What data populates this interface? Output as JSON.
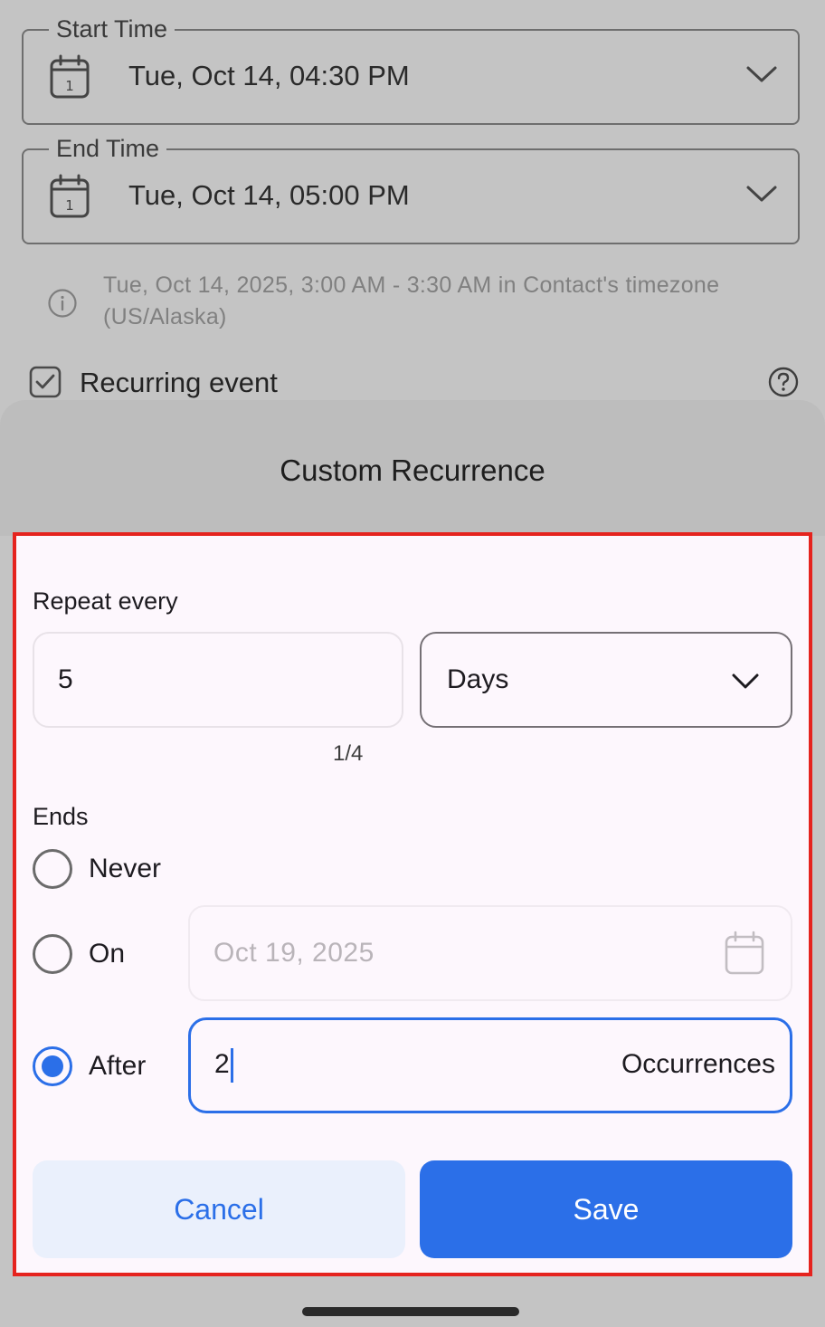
{
  "background_form": {
    "start_time": {
      "label": "Start Time",
      "value": "Tue, Oct 14, 04:30 PM",
      "icon": "calendar-icon"
    },
    "end_time": {
      "label": "End Time",
      "value": "Tue, Oct 14, 05:00 PM",
      "icon": "calendar-icon"
    },
    "timezone_info": {
      "text": "Tue, Oct 14, 2025, 3:00 AM - 3:30 AM in Contact's timezone (US/Alaska)",
      "icon": "info-icon"
    },
    "recurring": {
      "label": "Recurring event",
      "checked": true,
      "help_icon": "help-icon"
    }
  },
  "sheet": {
    "title": "Custom Recurrence",
    "repeat": {
      "label": "Repeat every",
      "value": "5",
      "counter": "1/4",
      "unit": "Days"
    },
    "ends": {
      "label": "Ends",
      "options": [
        {
          "id": "never",
          "label": "Never",
          "selected": false
        },
        {
          "id": "on",
          "label": "On",
          "selected": false
        },
        {
          "id": "after",
          "label": "After",
          "selected": true
        }
      ],
      "on_date": "Oct 19, 2025",
      "after_value": "2",
      "after_suffix": "Occurrences"
    },
    "buttons": {
      "cancel": "Cancel",
      "save": "Save"
    }
  },
  "colors": {
    "accent": "#2b6fe8",
    "highlight_border": "#e5231e",
    "sheet_background": "#fdf7fd",
    "scrim": "#c4c4c4"
  }
}
